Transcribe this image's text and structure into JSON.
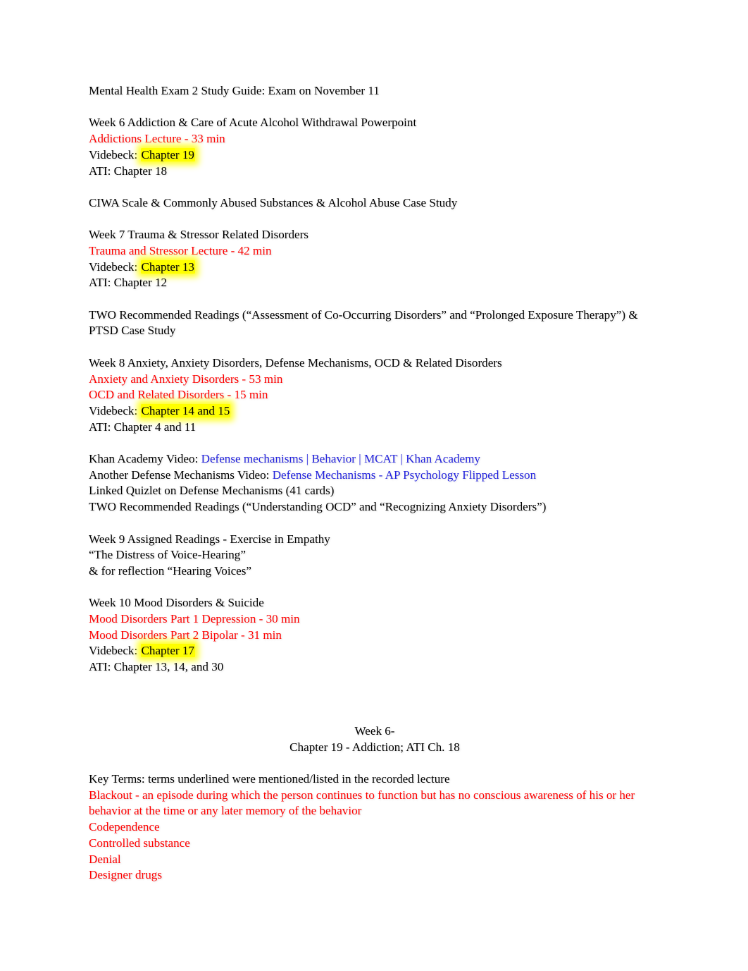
{
  "document": {
    "title_line": "Mental Health Exam 2 Study Guide: Exam on November 11",
    "colors": {
      "text": "#000000",
      "accent_red": "#ff0000",
      "link_blue": "#2222dd",
      "highlight_yellow": "#ffff00",
      "page_background": "#ffffff"
    },
    "week6": {
      "heading": "Week 6 Addiction & Care of Acute Alcohol Withdrawal Powerpoint",
      "lecture": "Addictions Lecture - 33 min",
      "videbeck_label": "Videbeck: ",
      "videbeck_chapter": "Chapter 19",
      "ati": "ATI: Chapter 18"
    },
    "ciwa_line": "CIWA Scale & Commonly Abused Substances & Alcohol Abuse Case Study",
    "week7": {
      "heading": "Week 7 Trauma & Stressor Related Disorders",
      "lecture": "Trauma and Stressor Lecture - 42 min",
      "videbeck_label": "Videbeck: ",
      "videbeck_chapter": "Chapter 13",
      "ati": "ATI: Chapter 12",
      "readings_line1": "TWO Recommended Readings (“Assessment of Co-Occurring Disorders” and “Prolonged Exposure Therapy”) &",
      "readings_line2": "PTSD Case Study"
    },
    "week8": {
      "heading": "Week 8 Anxiety, Anxiety Disorders, Defense Mechanisms, OCD & Related Disorders",
      "lecture1": "Anxiety and Anxiety Disorders - 53 min",
      "lecture2": "OCD and Related Disorders - 15 min",
      "videbeck_label": "Videbeck: ",
      "videbeck_chapter": "Chapter 14 and 15",
      "ati": "ATI: Chapter 4 and 11",
      "khan_label": "Khan Academy Video: ",
      "khan_link": "Defense mechanisms | Behavior | MCAT | Khan Academy",
      "another_label": "Another Defense Mechanisms Video: ",
      "another_link": "Defense Mechanisms - AP Psychology Flipped Lesson",
      "quizlet": "Linked Quizlet on Defense Mechanisms (41 cards)",
      "readings": "TWO Recommended Readings (“Understanding OCD” and “Recognizing Anxiety Disorders”)"
    },
    "week9": {
      "heading": "Week 9 Assigned Readings - Exercise in Empathy",
      "reading1": "“The Distress of Voice-Hearing”",
      "reading2": "& for reflection “Hearing Voices”"
    },
    "week10": {
      "heading": "Week 10 Mood Disorders & Suicide",
      "lecture1": "Mood Disorders Part 1 Depression - 30 min",
      "lecture2": "Mood Disorders Part 2 Bipolar - 31 min",
      "videbeck_label": "Videbeck: ",
      "videbeck_chapter": "Chapter 17",
      "ati": "ATI: Chapter 13, 14, and 30"
    },
    "section_header": {
      "line1": "Week 6-",
      "line2": "Chapter 19 - Addiction; ATI Ch. 18"
    },
    "key_terms": {
      "intro": "Key Terms: terms underlined were mentioned/listed in the recorded lecture",
      "blackout_line1": "Blackout - an episode during which the person continues to function but has no conscious awareness of his or her",
      "blackout_line2": "behavior at the time or any later memory of the behavior",
      "term_codependence": "Codependence",
      "term_controlled_substance": "Controlled substance",
      "term_denial": "Denial",
      "term_designer_drugs": "Designer drugs"
    }
  }
}
